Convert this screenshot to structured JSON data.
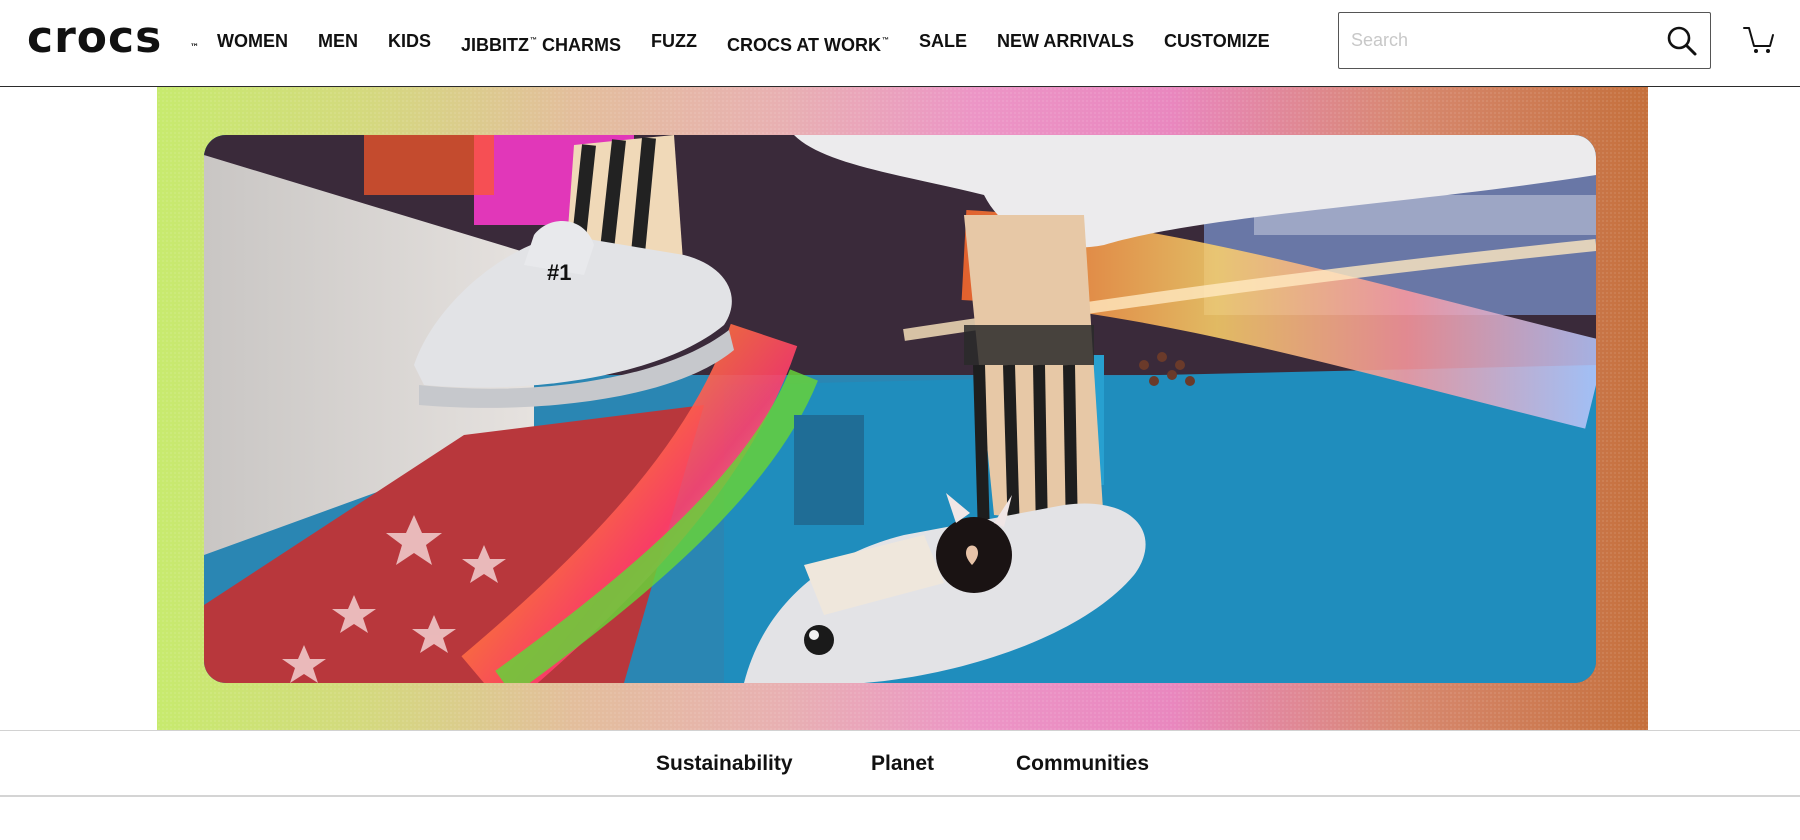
{
  "brand": {
    "logo_text": "crocs",
    "logo_tm": "™"
  },
  "header": {
    "nav_items": [
      {
        "label": "WOMEN",
        "tm": ""
      },
      {
        "label": "MEN",
        "tm": ""
      },
      {
        "label": "KIDS",
        "tm": ""
      },
      {
        "label": "JIBBITZ",
        "tm": "™",
        "suffix": " CHARMS"
      },
      {
        "label": "FUZZ",
        "tm": ""
      },
      {
        "label": "CROCS AT WORK",
        "tm": "™"
      },
      {
        "label": "SALE",
        "tm": ""
      },
      {
        "label": "NEW ARRIVALS",
        "tm": ""
      },
      {
        "label": "CUSTOMIZE",
        "tm": ""
      }
    ],
    "search": {
      "placeholder": "Search",
      "value": "",
      "icon": "search-icon"
    },
    "cart": {
      "icon": "cart-icon"
    }
  },
  "hero": {
    "gradient_colors": [
      "#c7ea6e",
      "#e3be9c",
      "#ec95c6",
      "#c5703c"
    ],
    "charms": {
      "number_one": "#1"
    }
  },
  "subnav": {
    "items": [
      {
        "label": "Sustainability"
      },
      {
        "label": "Planet"
      },
      {
        "label": "Communities"
      }
    ]
  }
}
